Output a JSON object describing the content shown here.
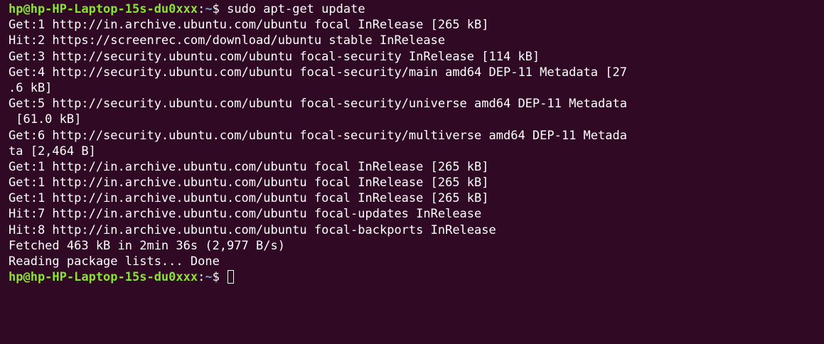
{
  "terminal": {
    "first_prompt": {
      "user_host": "hp@hp-HP-Laptop-15s-du0xxx",
      "separator": ":",
      "path": "~",
      "symbol": "$ ",
      "command": "sudo apt-get update"
    },
    "output_lines": [
      "Get:1 http://in.archive.ubuntu.com/ubuntu focal InRelease [265 kB]",
      "Hit:2 https://screenrec.com/download/ubuntu stable InRelease",
      "Get:3 http://security.ubuntu.com/ubuntu focal-security InRelease [114 kB]",
      "Get:4 http://security.ubuntu.com/ubuntu focal-security/main amd64 DEP-11 Metadata [27",
      ".6 kB]",
      "Get:5 http://security.ubuntu.com/ubuntu focal-security/universe amd64 DEP-11 Metadata",
      " [61.0 kB]",
      "Get:6 http://security.ubuntu.com/ubuntu focal-security/multiverse amd64 DEP-11 Metada",
      "ta [2,464 B]",
      "Get:1 http://in.archive.ubuntu.com/ubuntu focal InRelease [265 kB]",
      "Get:1 http://in.archive.ubuntu.com/ubuntu focal InRelease [265 kB]",
      "Get:1 http://in.archive.ubuntu.com/ubuntu focal InRelease [265 kB]",
      "Hit:7 http://in.archive.ubuntu.com/ubuntu focal-updates InRelease",
      "Hit:8 http://in.archive.ubuntu.com/ubuntu focal-backports InRelease",
      "Fetched 463 kB in 2min 36s (2,977 B/s)",
      "Reading package lists... Done"
    ],
    "last_prompt": {
      "user_host": "hp@hp-HP-Laptop-15s-du0xxx",
      "separator": ":",
      "path": "~",
      "symbol": "$ "
    }
  },
  "colors": {
    "background": "#300a24",
    "prompt_user": "#8ae234",
    "prompt_path": "#729fcf",
    "text": "#ffffff"
  },
  "icons": {
    "cursor": "block-cursor-icon"
  }
}
